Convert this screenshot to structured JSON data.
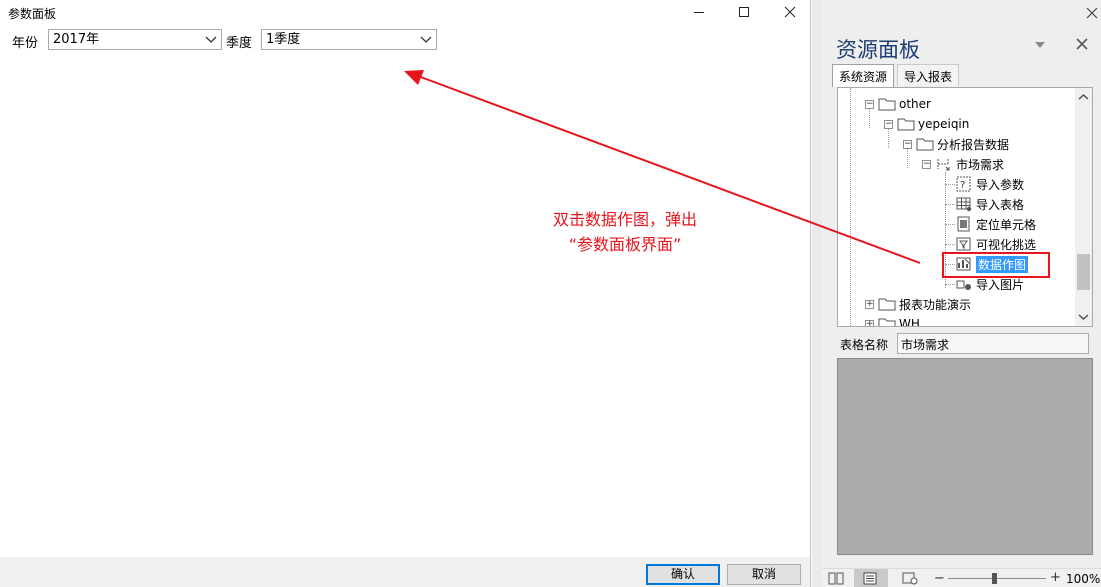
{
  "dialog": {
    "title": "参数面板",
    "year_label": "年份",
    "year_value": "2017年",
    "quarter_label": "季度",
    "quarter_value": "1季度",
    "ok_label": "确认",
    "cancel_label": "取消"
  },
  "annotation": {
    "line1": "双击数据作图，弹出",
    "line2": "“参数面板界面”",
    "color": "#e8141c"
  },
  "panel": {
    "title": "资源面板",
    "tabs": [
      "系统资源",
      "导入报表"
    ],
    "tree": {
      "other": "other",
      "yepeiqin": "yepeiqin",
      "report_data": "分析报告数据",
      "market": "市场需求",
      "children": [
        "导入参数",
        "导入表格",
        "定位单元格",
        "可视化挑选",
        "数据作图",
        "导入图片"
      ],
      "selected": "数据作图",
      "demo": "报表功能演示",
      "partial": "WH"
    },
    "name_label": "表格名称",
    "name_value": "市场需求"
  },
  "statusbar": {
    "zoom": "100%"
  }
}
